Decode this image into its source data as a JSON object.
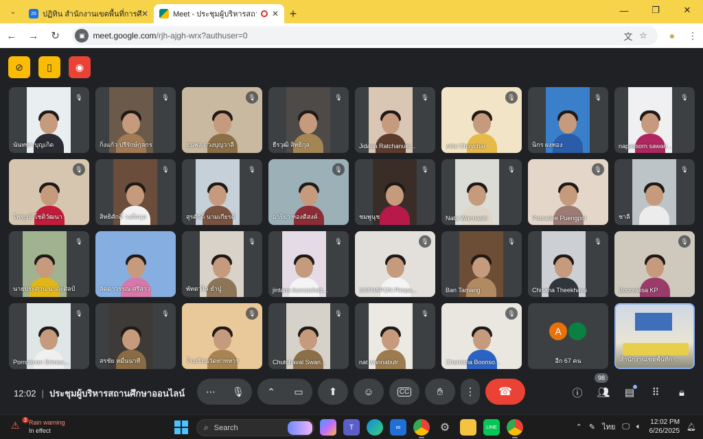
{
  "browser": {
    "tabs": [
      {
        "title": "ปฏิทิน สำนักงานเขตพื้นที่การศึกษาป",
        "favicon_color": "#1a73e8",
        "favicon_text": "26",
        "active": false
      },
      {
        "title": "Meet - ประชุมผู้บริหารสถานศึก",
        "favicon_color": "#00897b",
        "favicon_text": "",
        "active": true
      }
    ],
    "url_host": "meet.google.com",
    "url_path": "/rjh-ajgh-wrx?authuser=0"
  },
  "meet": {
    "tiles": [
      {
        "name": "นันทพร บุญเกิด",
        "bg": "#e9eef0",
        "body": "#2b2b33",
        "muted": true
      },
      {
        "name": "กิ่งแก้ว ปรีรักษ์กุลกร",
        "bg": "#6b5a4a",
        "body": "#a27b56",
        "muted": true
      },
      {
        "name": "ธนพล ดวงบุญวาลี",
        "bg": "#c9b9a0",
        "body": "#8c6f46",
        "muted": true
      },
      {
        "name": "ธีรวุฒิ สิทธิกุล",
        "bg": "#4e4a47",
        "body": "#a38654",
        "muted": true
      },
      {
        "name": "Jidapa Ratchanukr...",
        "bg": "#d9c7b4",
        "body": "#5b3b2c",
        "muted": true
      },
      {
        "name": "wilai Chuychai",
        "bg": "#f2e4c6",
        "body": "#e7b948",
        "muted": true
      },
      {
        "name": "นิกร ผงทอง",
        "bg": "#3a7fc9",
        "body": "#2a5ca8",
        "muted": true
      },
      {
        "name": "napassorn sawan...",
        "bg": "#f0f0f2",
        "body": "#b0265e",
        "muted": true
      },
      {
        "name": "ไพฑูรย์ โชติวัฒนา",
        "bg": "#d6c6b0",
        "body": "#c11c3b",
        "muted": true
      },
      {
        "name": "สิทธิศักดิ์ วงศ์สกุล",
        "bg": "#6a4d3b",
        "body": "#f2f2f2",
        "muted": true
      },
      {
        "name": "สุรศักดิ์ นามเกียรติ",
        "bg": "#c6d0d8",
        "body": "#7a5240",
        "muted": true
      },
      {
        "name": "อาริยา ทองดีสงค์",
        "bg": "#9cb0b8",
        "body": "#8c2c36",
        "muted": true
      },
      {
        "name": "ชมพูนุช",
        "bg": "#3a2d28",
        "body": "#b7194b",
        "muted": true
      },
      {
        "name": "Nata Wannasin",
        "bg": "#dcdcd6",
        "body": "#ded6c8",
        "muted": true
      },
      {
        "name": "Putsadee Puengpol",
        "bg": "#e4d7ca",
        "body": "#9b7b74",
        "muted": true
      },
      {
        "name": "ชาลี",
        "bg": "#bcc4c8",
        "body": "#ececec",
        "muted": true
      },
      {
        "name": "นายประศาน นาคะศิลป์",
        "bg": "#a0b28f",
        "body": "#e0b619",
        "muted": true
      },
      {
        "name": "ลัดดาวรรณ ศรีสาว",
        "bg": "#86aee0",
        "body": "#d678a8",
        "muted": false
      },
      {
        "name": "พัทตวไล ธำปู่",
        "bg": "#d9d2c9",
        "body": "#8d7558",
        "muted": true
      },
      {
        "name": "jintana buncachatt...",
        "bg": "#e4dbe6",
        "body": "#f4f4f4",
        "muted": true
      },
      {
        "name": "SATHAPON Pimpa...",
        "bg": "#e3e0db",
        "body": "#f4f4f4",
        "muted": true
      },
      {
        "name": "Ban Tamang",
        "bg": "#6c4d36",
        "body": "#b28a62",
        "muted": true
      },
      {
        "name": "Chisana Theekhayu",
        "bg": "#ccd0d4",
        "body": "#30363c",
        "muted": true
      },
      {
        "name": "Boonraksa KP",
        "bg": "#cfc9bd",
        "body": "#9b3b6a",
        "muted": true
      },
      {
        "name": "Pornpimon Srimos...",
        "bg": "#dfe6e6",
        "body": "#f0f0f0",
        "muted": true
      },
      {
        "name": "สรชัย หมื่นนาที",
        "bg": "#3d3a38",
        "body": "#8a6c44",
        "muted": true
      },
      {
        "name": "โรงเรียนวัดท่าทหาร",
        "bg": "#e9c89a",
        "body": "#a88452",
        "muted": true
      },
      {
        "name": "Chutchaval Swan...",
        "bg": "#d6d2ca",
        "body": "#8a6f49",
        "muted": true
      },
      {
        "name": "nat wannabutr",
        "bg": "#ece9e2",
        "body": "#9c7c4e",
        "muted": true
      },
      {
        "name": "Chantana Boonso...",
        "bg": "#eae7e1",
        "body": "#2a63c4",
        "muted": true
      }
    ],
    "others": {
      "label": "อีก 67 คน",
      "avatar1_letter": "A",
      "avatar1_color": "#e8710a",
      "avatar2_color": "#0b8043"
    },
    "selfview": {
      "name": "สำนักงานเขตพื้นที่กา..."
    },
    "time": "12:02",
    "meeting_title": "ประชุมผู้บริหารสถานศึกษาออนไลน์",
    "participants_count": "98"
  },
  "taskbar": {
    "weather_title": "Rain warning",
    "weather_sub": "In effect",
    "weather_badge": "3",
    "search_placeholder": "Search",
    "lang": "ไทย",
    "time": "12:02 PM",
    "date": "6/26/2025"
  },
  "colors": {
    "meet_yellow": "#fbbc04",
    "meet_red": "#ea4335",
    "accent_blue": "#8ab4f8"
  }
}
